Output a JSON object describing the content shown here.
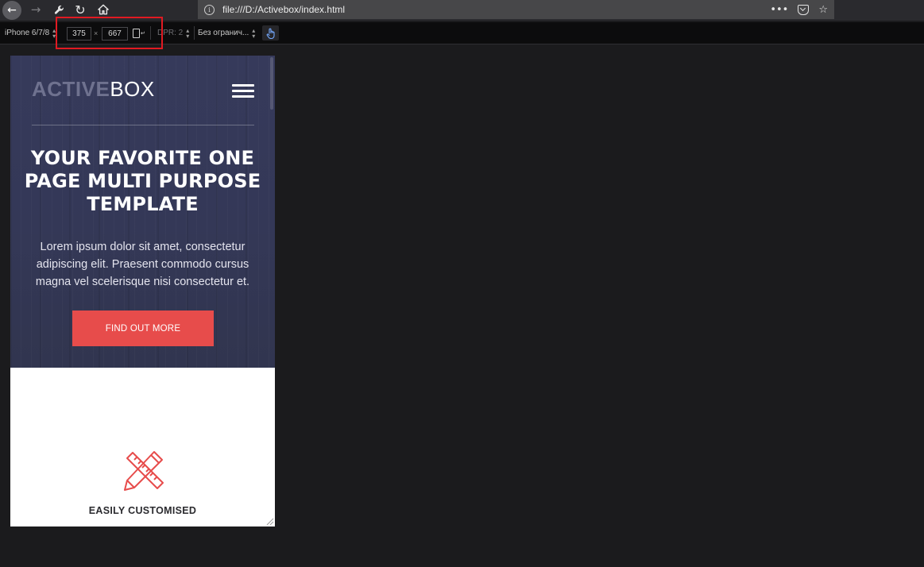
{
  "browser": {
    "icons": [
      "arrow-left-icon",
      "arrow-right-icon",
      "wrench-icon",
      "reload-icon",
      "home-icon",
      "info-icon",
      "more-dots-icon",
      "pocket-icon",
      "star-icon"
    ],
    "url": "file:///D:/Activebox/index.html",
    "page_actions": "•••"
  },
  "responsive_toolbar": {
    "device": "iPhone 6/7/8",
    "width": "375",
    "separator": "×",
    "height": "667",
    "dpr": "DPR: 2",
    "throttling": "Без огранич...",
    "icons": [
      "rotate-icon",
      "touch-icon",
      "select-caret-icon"
    ],
    "highlight_color": "#e11a22"
  },
  "page": {
    "logo_bold": "ACTIVE",
    "logo_light": "BOX",
    "hero_title": "YOUR FAVORITE ONE PAGE MULTI PURPOSE TEMPLATE",
    "hero_text": "Lorem ipsum dolor sit amet, consectetur adipiscing elit. Praesent commodo cursus magna vel scelerisque nisi consectetur et.",
    "cta_label": "FIND OUT MORE",
    "feature_title": "EASILY CUSTOMISED",
    "icons": [
      "hamburger-menu-icon",
      "pencil-ruler-icon"
    ],
    "colors": {
      "hero_background": "#353956",
      "accent": "#e74c4b",
      "logo_bold": "#6f728f"
    }
  }
}
